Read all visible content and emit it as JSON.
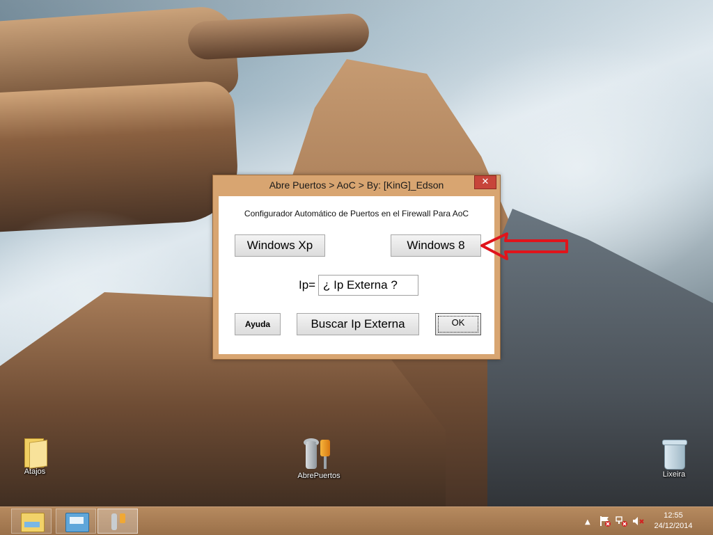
{
  "dialog": {
    "title": "Abre Puertos > AoC > By: [KinG]_Edson",
    "close_label": "✕",
    "heading": "Configurador Automático de Puertos en el Firewall Para AoC",
    "btn_windows_xp": "Windows Xp",
    "btn_windows_8": "Windows 8",
    "ip_label": "Ip=",
    "ip_value": "¿ Ip Externa ?",
    "btn_help": "Ayuda",
    "btn_search_ip": "Buscar Ip Externa",
    "btn_ok": "OK"
  },
  "desktop_icons": [
    {
      "label": "Atajos",
      "icon": "folder-icon"
    },
    {
      "label": "AbrePuertos",
      "icon": "tools-icon"
    },
    {
      "label": "Lixeira",
      "icon": "recycle-bin-icon"
    }
  ],
  "taskbar": {
    "pinned": [
      {
        "icon": "file-explorer-icon"
      },
      {
        "icon": "control-panel-icon"
      },
      {
        "icon": "abrepuertos-icon",
        "active": true
      }
    ],
    "tray": {
      "show_hidden": "▲",
      "time": "12:55",
      "date": "24/12/2014"
    }
  },
  "annotation": {
    "color": "#e0141b",
    "icon": "red-arrow-icon"
  }
}
